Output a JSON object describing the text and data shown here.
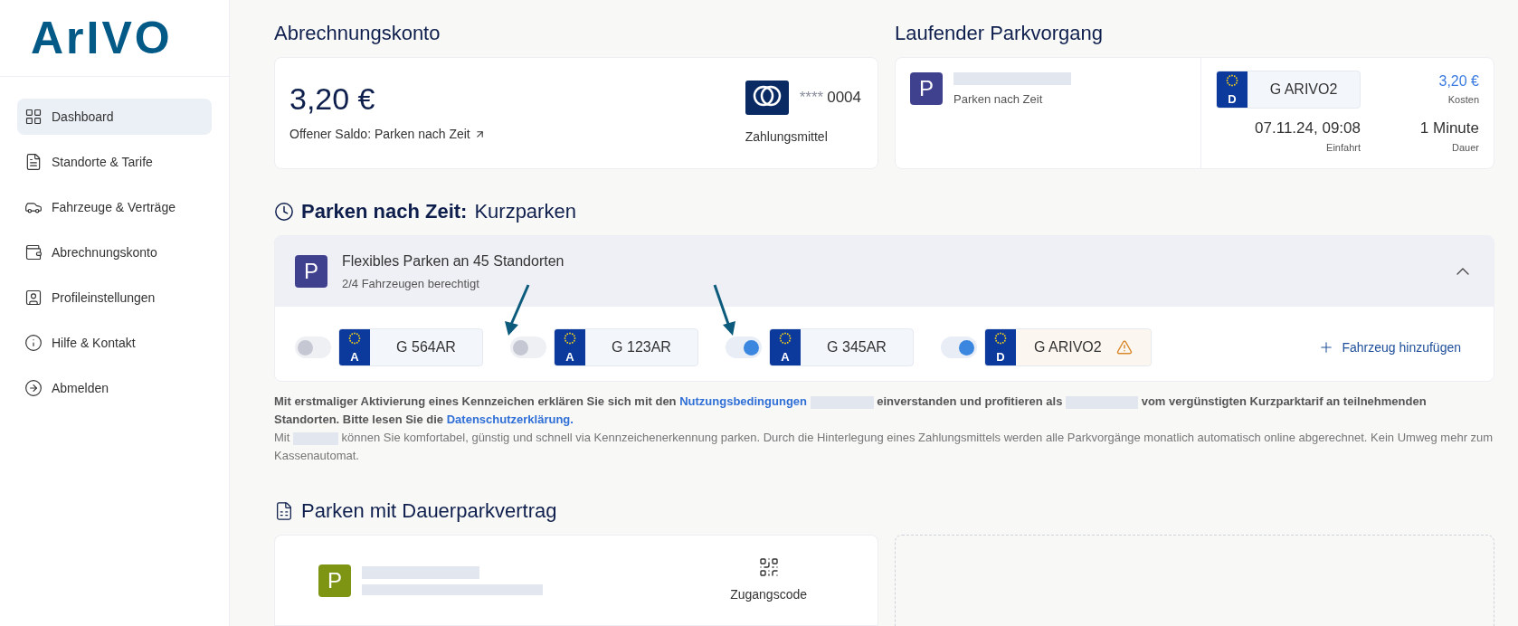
{
  "sidebar": {
    "logo": "ArIVO",
    "items": [
      {
        "label": "Dashboard",
        "selected": true
      },
      {
        "label": "Standorte & Tarife",
        "selected": false
      },
      {
        "label": "Fahrzeuge & Verträge",
        "selected": false
      },
      {
        "label": "Abrechnungskonto",
        "selected": false
      },
      {
        "label": "Profileinstellungen",
        "selected": false
      },
      {
        "label": "Hilfe & Kontakt",
        "selected": false
      },
      {
        "label": "Abmelden",
        "selected": false
      }
    ]
  },
  "account": {
    "title": "Abrechnungskonto",
    "balance": "3,20 €",
    "balance_link": "Offener Saldo: Parken nach Zeit",
    "card_mask": "****",
    "card_number": "0004",
    "payment_label": "Zahlungsmittel"
  },
  "current_parking": {
    "title": "Laufender Parkvorgang",
    "icon": "P",
    "type": "Parken nach Zeit",
    "plate": {
      "country": "D",
      "number": "G ARIVO2"
    },
    "cost": "3,20 €",
    "cost_label": "Kosten",
    "entry": "07.11.24, 09:08",
    "entry_label": "Einfahrt",
    "duration": "1 Minute",
    "duration_label": "Dauer"
  },
  "time_parking": {
    "title": "Parken nach Zeit:",
    "subtitle": "Kurzparken",
    "offer": {
      "icon": "P",
      "title": "Flexibles Parken an 45 Standorten",
      "subtitle": "2/4 Fahrzeugen berechtigt",
      "expanded": true
    },
    "vehicles": [
      {
        "on": false,
        "country": "A",
        "number": "G 564AR",
        "warning": false
      },
      {
        "on": false,
        "country": "A",
        "number": "G 123AR",
        "warning": false
      },
      {
        "on": true,
        "country": "A",
        "number": "G 345AR",
        "warning": false
      },
      {
        "on": true,
        "country": "D",
        "number": "G ARIVO2",
        "warning": true
      }
    ],
    "add_vehicle": "Fahrzeug hinzufügen",
    "notice": {
      "part_1": "Mit erstmaliger Aktivierung eines Kennzeichen erklären Sie sich mit den",
      "terms_link": "Nutzungsbedingungen",
      "part_2": "einverstanden und profitieren als",
      "part_3": "vom vergünstigten Kurzparktarif an teilnehmenden Standorten. Bitte lesen Sie die",
      "privacy_link": "Datenschutzerklärung."
    },
    "info": {
      "part_1": "Mit",
      "part_2": "können Sie komfortabel, günstig und schnell via Kennzeichenerkennung parken. Durch die Hinterlegung eines Zahlungsmittels werden alle Parkvorgänge monatlich automatisch online abgerechnet. Kein Umweg mehr zum Kassenautomat."
    }
  },
  "contract_parking": {
    "title": "Parken mit Dauerparkvertrag",
    "icon": "P",
    "access_code": "Zugangscode"
  }
}
